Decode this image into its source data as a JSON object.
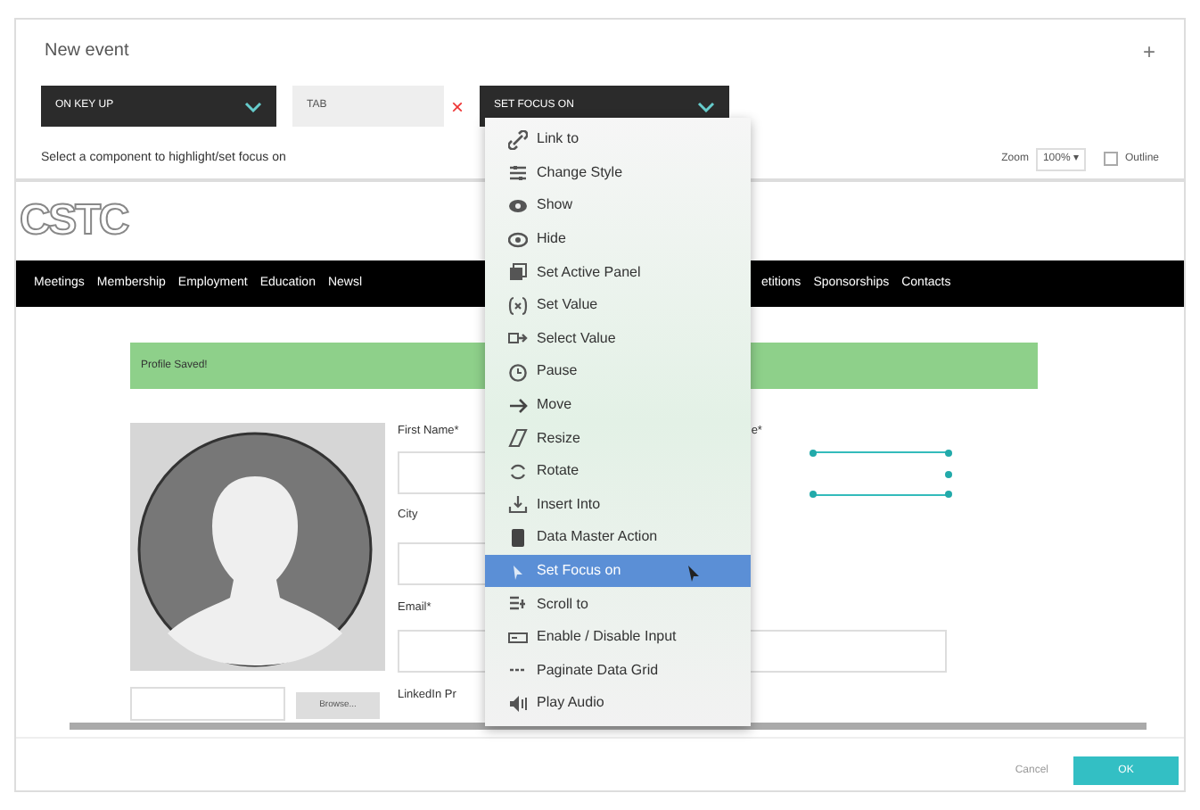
{
  "dialog": {
    "title": "New event",
    "close": "+"
  },
  "controls": {
    "event": "ON KEY UP",
    "target": "TAB",
    "remove": "×",
    "action": "SET FOCUS ON"
  },
  "hint": "Select a component to highlight/set focus on",
  "zoom": {
    "label": "Zoom",
    "value": "100%",
    "caret": "▾"
  },
  "outline": {
    "label": "Outline",
    "checked": false
  },
  "preview": {
    "logo": "CSTC",
    "nav_left": [
      "Meetings",
      "Membership",
      "Employment",
      "Education",
      "Newsl"
    ],
    "nav_right": [
      "etitions",
      "Sponsorships",
      "Contacts"
    ],
    "banner": "Profile Saved!",
    "labels": {
      "first_name": "First Name*",
      "right": "e*",
      "city": "City",
      "email": "Email*",
      "linkedin": "LinkedIn Pr"
    },
    "browse": "Browse..."
  },
  "menu": [
    {
      "label": "Link to",
      "selected": false
    },
    {
      "label": "Change Style",
      "selected": false
    },
    {
      "label": "Show",
      "selected": false
    },
    {
      "label": "Hide",
      "selected": false
    },
    {
      "label": "Set Active Panel",
      "selected": false
    },
    {
      "label": "Set Value",
      "selected": false
    },
    {
      "label": "Select Value",
      "selected": false
    },
    {
      "label": "Pause",
      "selected": false
    },
    {
      "label": "Move",
      "selected": false
    },
    {
      "label": "Resize",
      "selected": false
    },
    {
      "label": "Rotate",
      "selected": false
    },
    {
      "label": "Insert Into",
      "selected": false
    },
    {
      "label": "Data Master Action",
      "selected": false
    },
    {
      "label": "Set Focus on",
      "selected": true
    },
    {
      "label": "Scroll to",
      "selected": false
    },
    {
      "label": "Enable / Disable Input",
      "selected": false
    },
    {
      "label": "Paginate Data Grid",
      "selected": false
    },
    {
      "label": "Play Audio",
      "selected": false
    }
  ],
  "footer": {
    "cancel": "Cancel",
    "ok": "OK"
  }
}
